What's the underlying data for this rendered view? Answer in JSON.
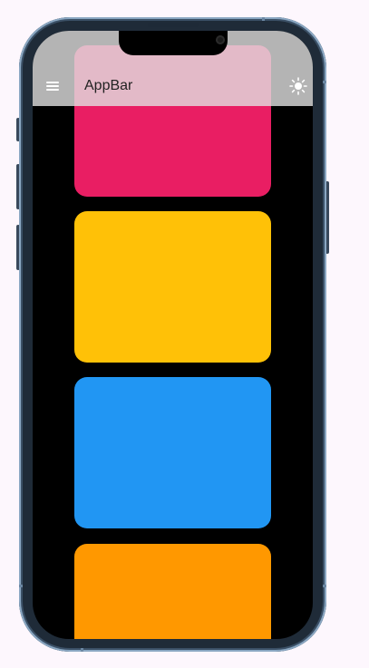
{
  "appbar": {
    "title": "AppBar",
    "background": "#e1e1e1",
    "menu_icon": "menu-icon",
    "theme_icon": "sun-icon"
  },
  "cards": [
    {
      "name": "pink-card",
      "color": "#e91e63"
    },
    {
      "name": "amber-card",
      "color": "#ffc107"
    },
    {
      "name": "blue-card",
      "color": "#2196f3"
    },
    {
      "name": "orange-card",
      "color": "#ff9800"
    }
  ],
  "colors": {
    "page_background": "#fdf7fd",
    "screen_background": "#000000",
    "frame": "#1f2b38",
    "frame_edge": "#8aa7c2"
  }
}
